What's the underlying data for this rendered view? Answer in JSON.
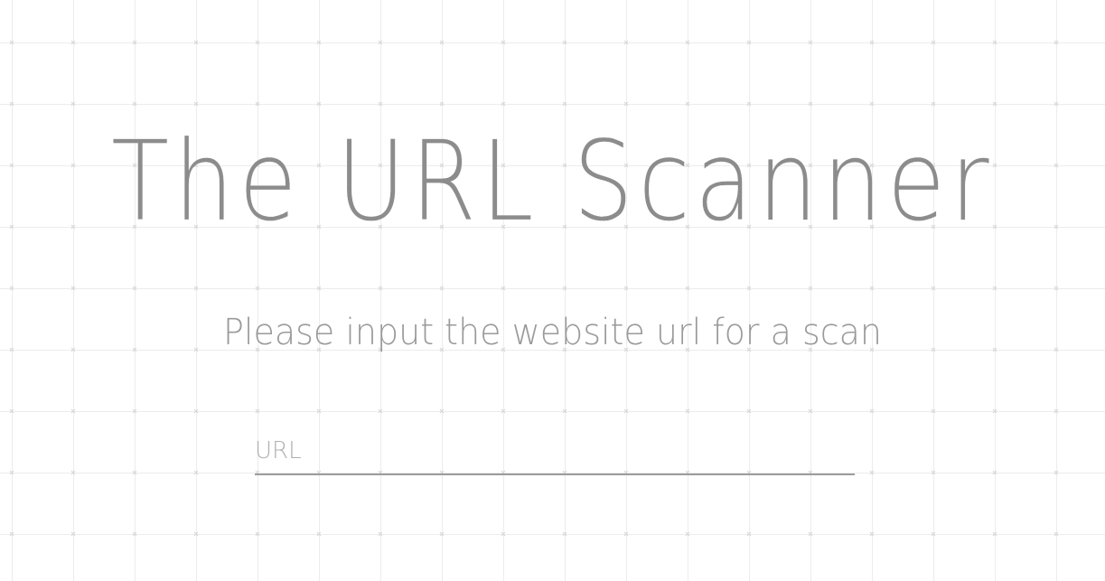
{
  "page": {
    "title": "The URL Scanner",
    "subtitle": "Please input the website url for a scan"
  },
  "form": {
    "url_placeholder": "URL",
    "url_value": ""
  },
  "colors": {
    "text": "#8f8f8f",
    "grid": "#ececec",
    "background": "#ffffff"
  }
}
